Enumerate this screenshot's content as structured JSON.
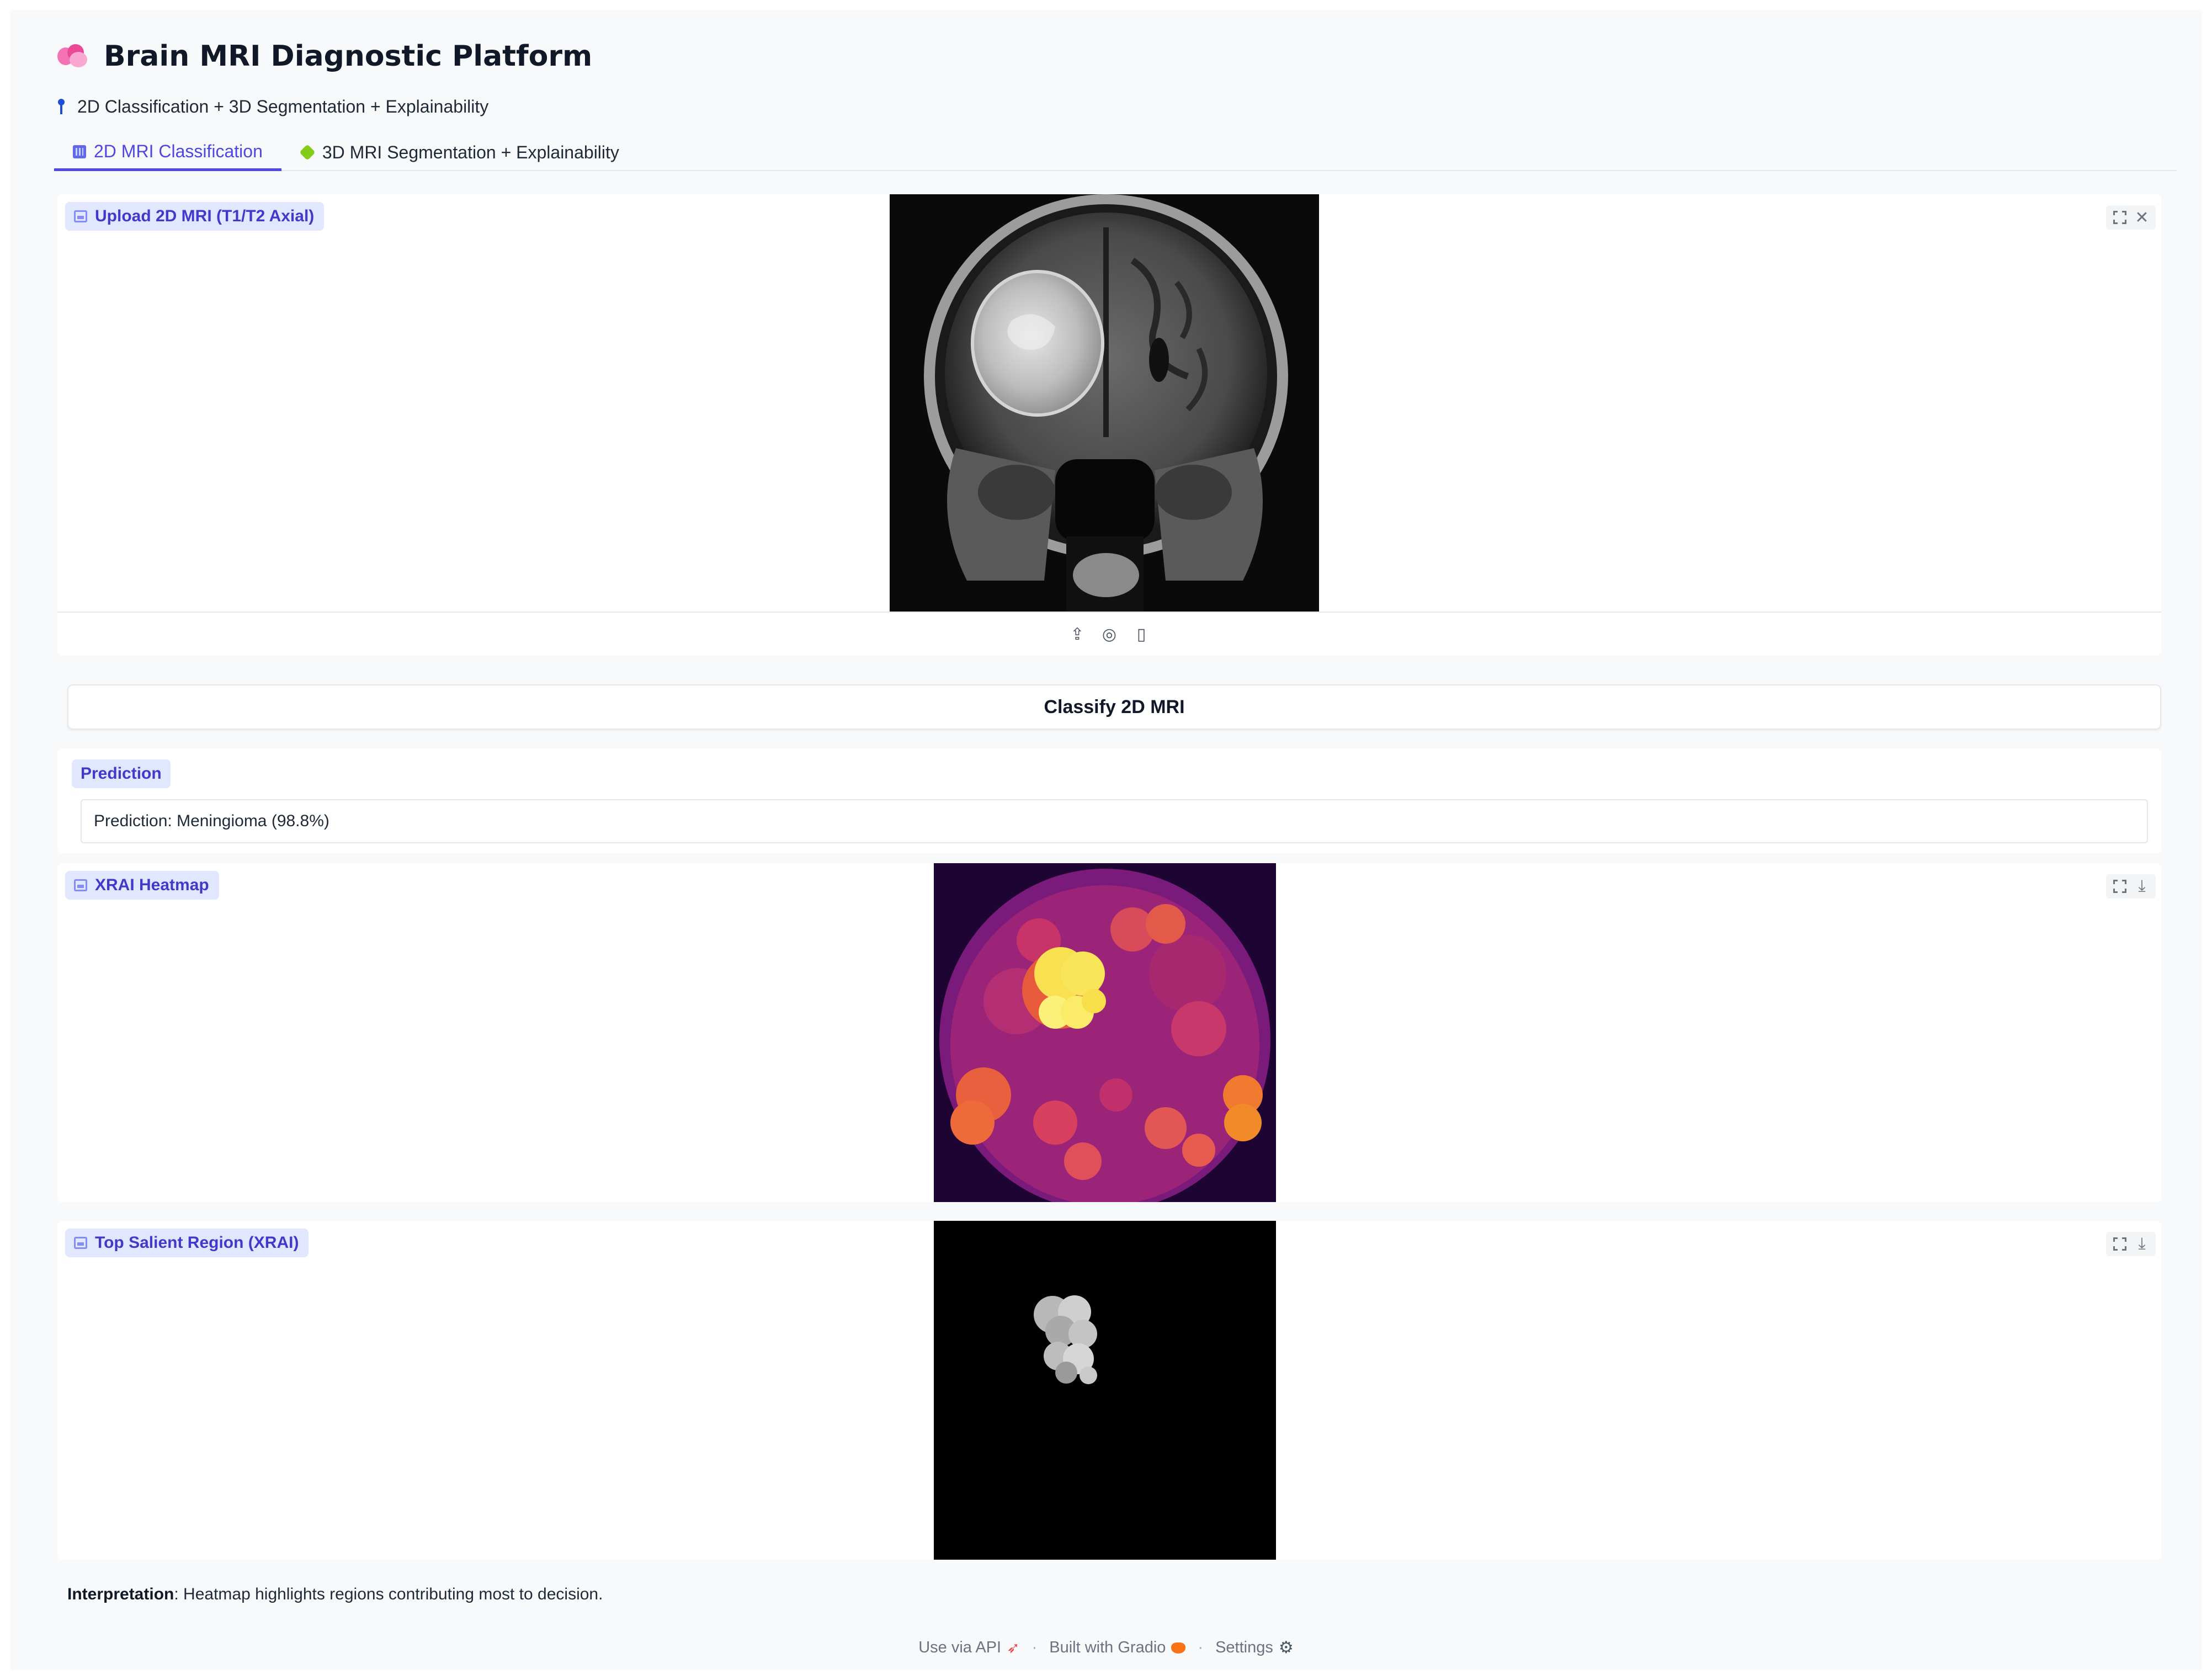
{
  "app": {
    "title": "Brain MRI Diagnostic Platform",
    "subtitle": "2D Classification + 3D Segmentation + Explainability"
  },
  "tabs": [
    {
      "label": "2D MRI Classification",
      "icon": "bar-chart-icon",
      "active": true
    },
    {
      "label": "3D MRI Segmentation + Explainability",
      "icon": "puzzle-icon",
      "active": false
    }
  ],
  "upload": {
    "label": "Upload 2D MRI (T1/T2 Axial)",
    "icons": [
      "fullscreen-icon",
      "close-icon",
      "upload-icon",
      "webcam-icon",
      "clipboard-icon"
    ]
  },
  "classify_button": "Classify 2D MRI",
  "prediction": {
    "label": "Prediction",
    "text": "Prediction: Meningioma (98.8%)"
  },
  "heatmap": {
    "label": "XRAI Heatmap"
  },
  "salient": {
    "label": "Top Salient Region (XRAI)"
  },
  "interpretation": {
    "title": "Interpretation",
    "text": ": Heatmap highlights regions contributing most to decision."
  },
  "footer": {
    "api": "Use via API",
    "built": "Built with Gradio",
    "settings": "Settings",
    "separator": "·"
  },
  "colors": {
    "accent": "#4f46e5",
    "label_bg": "#e0e7ff",
    "page_bg": "#f7f9fb"
  }
}
